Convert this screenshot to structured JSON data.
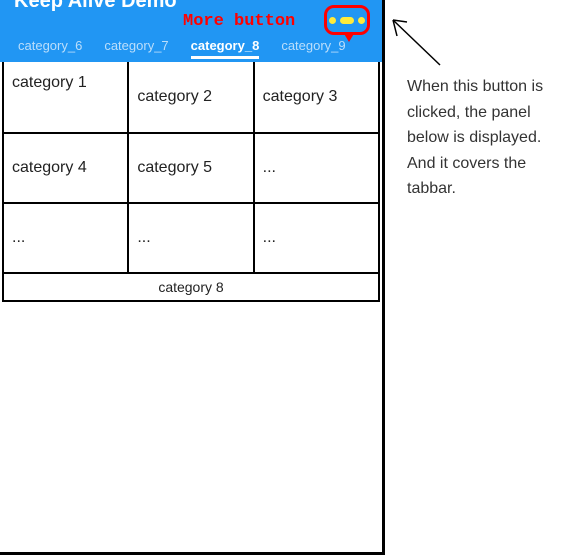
{
  "header": {
    "app_title": "Keep Alive Demo",
    "more_label": "More button"
  },
  "tabs": {
    "t0": "category_6",
    "t1": "category_7",
    "t2": "category_8",
    "t3": "category_9"
  },
  "grid": {
    "r0c0": "category 1",
    "r0c1": "category 2",
    "r0c2": "category 3",
    "r1c0": "category 4",
    "r1c1": "category 5",
    "r1c2": "...",
    "r2c0": "...",
    "r2c1": "...",
    "r2c2": "...",
    "bottom_label": "category 8"
  },
  "annotation": {
    "line1": "When this button is",
    "line2": "clicked, the panel",
    "line3": "below is displayed.",
    "line4": "And it covers the",
    "line5": "tabbar."
  }
}
